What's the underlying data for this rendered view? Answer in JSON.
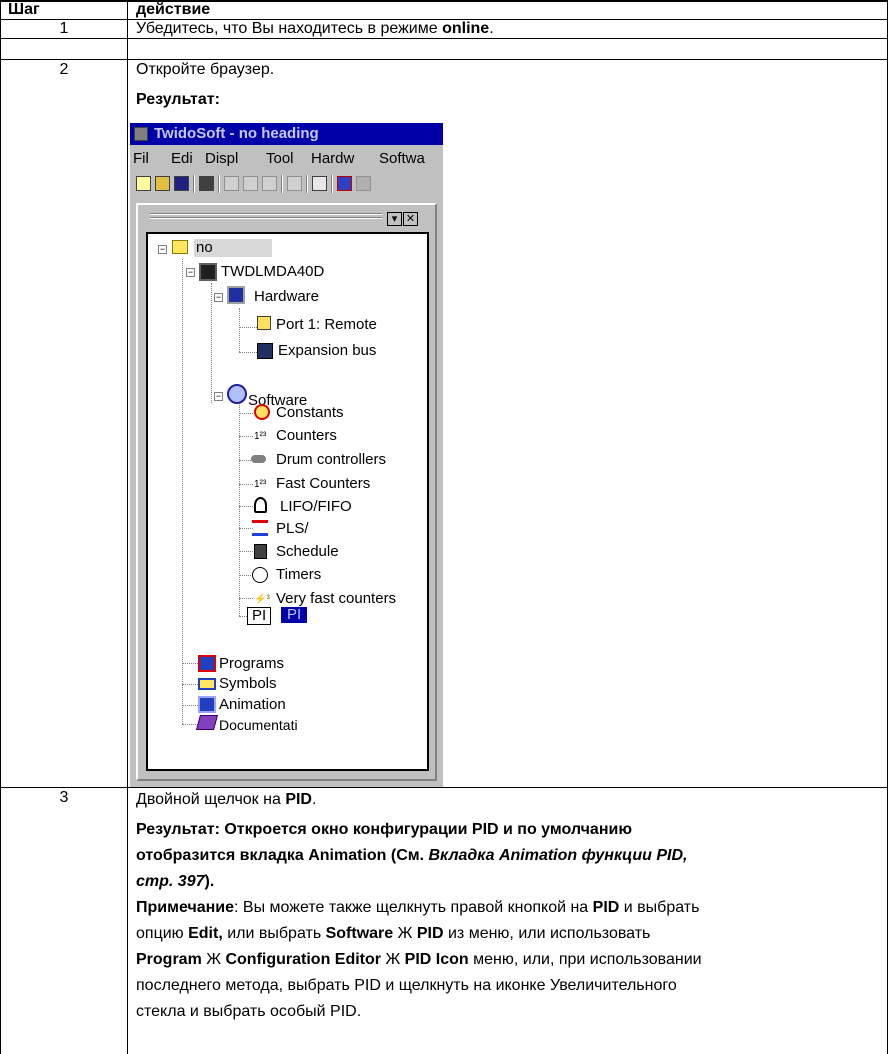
{
  "table": {
    "col_step": "Шаг",
    "col_action": "действие",
    "rows": [
      {
        "num": "1",
        "line1_a": "Убедитесь, что Вы находитесь в режиме ",
        "line1_b": "online",
        "line1_c": "."
      },
      {
        "num": "2",
        "line1": "Откройте браузер.",
        "line2": "Результат:"
      },
      {
        "num": "3"
      }
    ]
  },
  "step3": {
    "l1_a": "Двойной щелчок на ",
    "l1_b": "PID",
    "l1_c": ".",
    "l2": "Результат: Откроется окно конфигурации PID и по умолчанию",
    "l3_a": "отобразится вкладка Animation (См. ",
    "l3_b": "Вкладка Animation функции PID,",
    "l4_a": "стр. 397",
    "l4_b": ").",
    "l5_a": "Примечание",
    "l5_b": ": Вы можете также щелкнуть правой кнопкой на ",
    "l5_c": "PID",
    "l5_d": " и выбрать",
    "l6_a": "опцию ",
    "l6_b": "Edit,",
    "l6_c": " или выбрать ",
    "l6_d": "Software",
    "l6_e": " Ж ",
    "l6_f": "PID",
    "l6_g": " из меню, или использовать",
    "l7_a": "Program",
    "l7_b": " Ж ",
    "l7_c": "Configuration Editor",
    "l7_d": " Ж ",
    "l7_e": "PID Icon",
    "l7_f": " меню, или, при использовании",
    "l8": "последнего метода, выбрать PID и щелкнуть на иконке Увеличительного",
    "l9": "стекла и выбрать особый PID."
  },
  "screenshot": {
    "title": "TwidoSoft - no heading",
    "menu": [
      "Fil",
      "Edi",
      "Displ",
      "Tool",
      "Hardw",
      "Softwa"
    ],
    "tree": {
      "root": "no",
      "controller": "TWDLMDA40D",
      "hardware": "Hardware",
      "port": "Port 1: Remote",
      "expansion": "Expansion bus",
      "software": "Software",
      "software_items": [
        "Constants",
        "Counters",
        "Drum controllers",
        "Fast Counters",
        "LIFO/FIFO",
        "PLS/",
        "Schedule",
        "Timers",
        "Very fast counters"
      ],
      "pid_a": "PI",
      "pid_b": "PI",
      "programs": "Programs",
      "symbols": "Symbols",
      "animation": "Animation",
      "documentation": "Documentati"
    }
  },
  "colors": {
    "titlebar": "#0000a8",
    "selection": "#0000a8",
    "window": "#c0c0c0"
  }
}
